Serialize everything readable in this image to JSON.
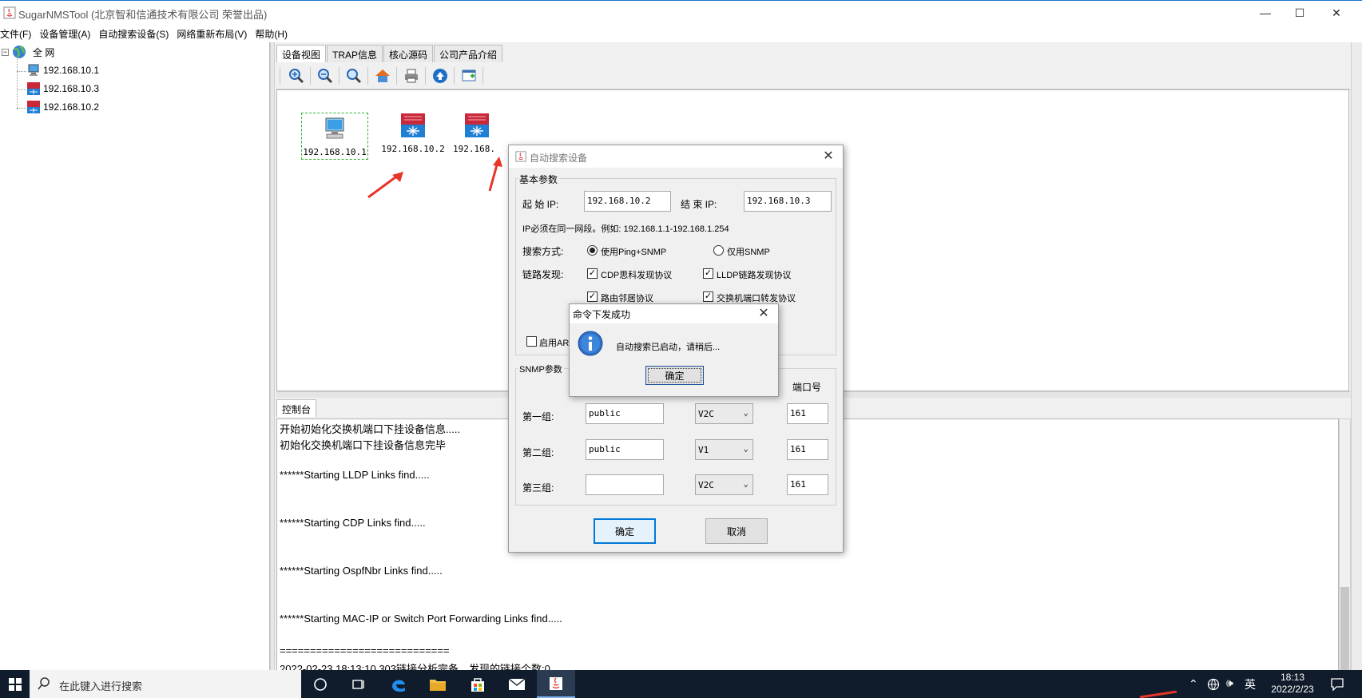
{
  "window": {
    "title": "SugarNMSTool (北京智和信通技术有限公司 荣誉出品)",
    "minimize": "—",
    "maximize": "☐",
    "close": "✕"
  },
  "menu": [
    "文件(F)",
    "设备管理(A)",
    "自动搜索设备(S)",
    "网络重新布局(V)",
    "帮助(H)"
  ],
  "tree": {
    "root": "全 网",
    "items": [
      "192.168.10.1",
      "192.168.10.3",
      "192.168.10.2"
    ]
  },
  "tabs": [
    "设备视图",
    "TRAP信息",
    "核心源码",
    "公司产品介绍"
  ],
  "toolbar_icons": [
    "zoom-in-icon",
    "zoom-out-icon",
    "zoom-fit-icon",
    "home-icon",
    "print-icon",
    "up-arrow-icon",
    "export-icon"
  ],
  "devices": [
    {
      "label": "192.168.10.1",
      "type": "host"
    },
    {
      "label": "192.168.10.2",
      "type": "switch"
    },
    {
      "label": "192.168.",
      "type": "switch"
    }
  ],
  "console": {
    "tab": "控制台",
    "lines": [
      "开始初始化交换机端口下挂设备信息.....",
      "初始化交换机端口下挂设备信息完毕",
      "******Starting LLDP Links find.....",
      "******Starting CDP Links find.....",
      "******Starting OspfNbr Links find.....",
      "******Starting MAC-IP or Switch Port Forwarding Links find.....",
      "============================",
      "2022-02-23 18:13:10.303链接分析完备，发现的链接个数:0"
    ]
  },
  "search_dialog": {
    "title": "自动搜索设备",
    "basic_legend": "基本参数",
    "start_ip_label": "起 始 IP:",
    "start_ip": "192.168.10.2",
    "end_ip_label": "结 束 IP:",
    "end_ip": "192.168.10.3",
    "hint": "IP必须在同一网段。例如: 192.168.1.1-192.168.1.254",
    "search_mode_label": "搜索方式:",
    "mode_ping_snmp": "使用Ping+SNMP",
    "mode_snmp_only": "仅用SNMP",
    "link_label": "链路发现:",
    "cdp": "CDP思科发现协议",
    "lldp": "LLDP链路发现协议",
    "route": "路由邻居协议",
    "switch_fwd": "交换机端口转发协议",
    "arp": "启用ARI",
    "snmp_legend": "SNMP参数",
    "port_header": "端口号",
    "groups": [
      {
        "label": "第一组:",
        "community": "public",
        "version": "V2C",
        "port": "161"
      },
      {
        "label": "第二组:",
        "community": "public",
        "version": "V1",
        "port": "161"
      },
      {
        "label": "第三组:",
        "community": "",
        "version": "V2C",
        "port": "161"
      }
    ],
    "ok": "确定",
    "cancel": "取消"
  },
  "msg_dialog": {
    "title": "命令下发成功",
    "message": "自动搜索已启动，请稍后...",
    "ok": "确定"
  },
  "taskbar": {
    "search_placeholder": "在此键入进行搜索",
    "ime": "英",
    "time": "18:13",
    "date": "2022/2/23"
  },
  "colors": {
    "accent": "#0078d7",
    "taskbar": "#101c2b",
    "arrow": "#e8352a",
    "selection_dash": "#2bb52b"
  }
}
